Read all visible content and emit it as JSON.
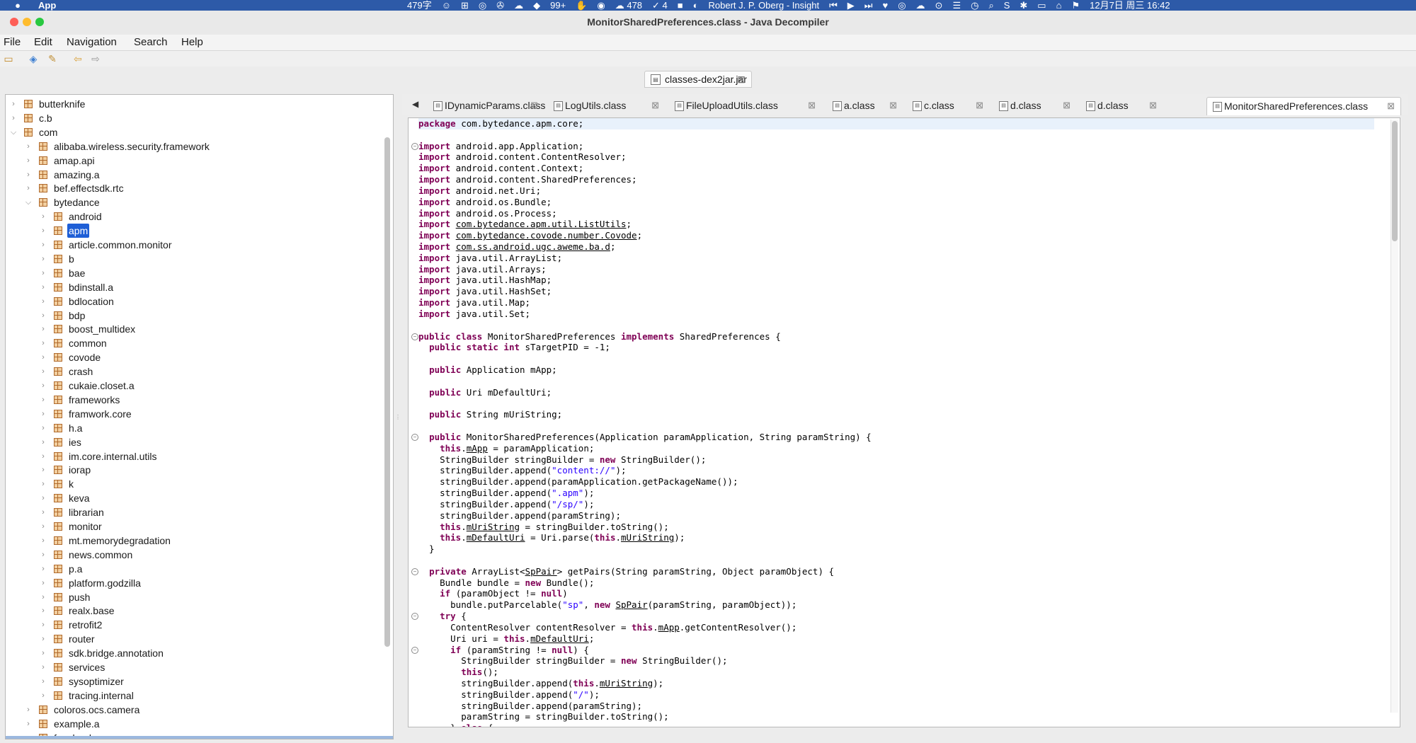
{
  "menubar": {
    "app_name": "App",
    "status": [
      "479字",
      "☺",
      "⊞",
      "◎",
      "✇",
      "☁",
      "◆",
      "99+",
      "✋",
      "◉",
      "☁ 478",
      "✓ 4",
      "■",
      "◐",
      "Robert J. P. Oberg - Insight",
      "⏮",
      "▶",
      "⏭",
      "♥",
      "◎",
      "☁",
      "⊙",
      "☰",
      "◷",
      "⌕",
      "S",
      "✱",
      "▭",
      "⌂",
      "⚑",
      "12月7日 周三  16:42"
    ]
  },
  "window": {
    "title": "MonitorSharedPreferences.class - Java Decompiler"
  },
  "menu": {
    "items": [
      "File",
      "Edit",
      "Navigation",
      "Search",
      "Help"
    ]
  },
  "toolbar": {
    "icons": [
      "open-folder-icon",
      "open-type-icon",
      "search-icon",
      "back-icon",
      "forward-icon"
    ]
  },
  "jar_tab": {
    "label": "classes-dex2jar.jar"
  },
  "tree": [
    {
      "name": "butterknife",
      "depth": 0,
      "expanded": false
    },
    {
      "name": "c.b",
      "depth": 0,
      "expanded": false
    },
    {
      "name": "com",
      "depth": 0,
      "expanded": true
    },
    {
      "name": "alibaba.wireless.security.framework",
      "depth": 1,
      "expanded": false
    },
    {
      "name": "amap.api",
      "depth": 1,
      "expanded": false
    },
    {
      "name": "amazing.a",
      "depth": 1,
      "expanded": false
    },
    {
      "name": "bef.effectsdk.rtc",
      "depth": 1,
      "expanded": false
    },
    {
      "name": "bytedance",
      "depth": 1,
      "expanded": true
    },
    {
      "name": "android",
      "depth": 2,
      "expanded": false
    },
    {
      "name": "apm",
      "depth": 2,
      "expanded": false,
      "selected": true
    },
    {
      "name": "article.common.monitor",
      "depth": 2,
      "expanded": false
    },
    {
      "name": "b",
      "depth": 2,
      "expanded": false
    },
    {
      "name": "bae",
      "depth": 2,
      "expanded": false
    },
    {
      "name": "bdinstall.a",
      "depth": 2,
      "expanded": false
    },
    {
      "name": "bdlocation",
      "depth": 2,
      "expanded": false
    },
    {
      "name": "bdp",
      "depth": 2,
      "expanded": false
    },
    {
      "name": "boost_multidex",
      "depth": 2,
      "expanded": false
    },
    {
      "name": "common",
      "depth": 2,
      "expanded": false
    },
    {
      "name": "covode",
      "depth": 2,
      "expanded": false
    },
    {
      "name": "crash",
      "depth": 2,
      "expanded": false
    },
    {
      "name": "cukaie.closet.a",
      "depth": 2,
      "expanded": false
    },
    {
      "name": "frameworks",
      "depth": 2,
      "expanded": false
    },
    {
      "name": "framwork.core",
      "depth": 2,
      "expanded": false
    },
    {
      "name": "h.a",
      "depth": 2,
      "expanded": false
    },
    {
      "name": "ies",
      "depth": 2,
      "expanded": false
    },
    {
      "name": "im.core.internal.utils",
      "depth": 2,
      "expanded": false
    },
    {
      "name": "iorap",
      "depth": 2,
      "expanded": false
    },
    {
      "name": "k",
      "depth": 2,
      "expanded": false
    },
    {
      "name": "keva",
      "depth": 2,
      "expanded": false
    },
    {
      "name": "librarian",
      "depth": 2,
      "expanded": false
    },
    {
      "name": "monitor",
      "depth": 2,
      "expanded": false
    },
    {
      "name": "mt.memorydegradation",
      "depth": 2,
      "expanded": false
    },
    {
      "name": "news.common",
      "depth": 2,
      "expanded": false
    },
    {
      "name": "p.a",
      "depth": 2,
      "expanded": false
    },
    {
      "name": "platform.godzilla",
      "depth": 2,
      "expanded": false
    },
    {
      "name": "push",
      "depth": 2,
      "expanded": false
    },
    {
      "name": "realx.base",
      "depth": 2,
      "expanded": false
    },
    {
      "name": "retrofit2",
      "depth": 2,
      "expanded": false
    },
    {
      "name": "router",
      "depth": 2,
      "expanded": false
    },
    {
      "name": "sdk.bridge.annotation",
      "depth": 2,
      "expanded": false
    },
    {
      "name": "services",
      "depth": 2,
      "expanded": false
    },
    {
      "name": "sysoptimizer",
      "depth": 2,
      "expanded": false
    },
    {
      "name": "tracing.internal",
      "depth": 2,
      "expanded": false
    },
    {
      "name": "coloros.ocs.camera",
      "depth": 1,
      "expanded": false
    },
    {
      "name": "example.a",
      "depth": 1,
      "expanded": false
    },
    {
      "name": "facebook",
      "depth": 1,
      "expanded": false
    }
  ],
  "editor_tabs": [
    {
      "label": "IDynamicParams.class",
      "active": false
    },
    {
      "label": "LogUtils.class",
      "active": false
    },
    {
      "label": "FileUploadUtils.class",
      "active": false
    },
    {
      "label": "a.class",
      "active": false
    },
    {
      "label": "c.class",
      "active": false
    },
    {
      "label": "d.class",
      "active": false
    },
    {
      "label": "d.class",
      "active": false
    },
    {
      "label": "MonitorSharedPreferences.class",
      "active": true
    }
  ],
  "tab_close_glyph": "⊠",
  "code_lines": [
    [
      [
        "kw",
        "package"
      ],
      [
        "t",
        " com.bytedance.apm.core;"
      ]
    ],
    [],
    [
      [
        "kw",
        "import"
      ],
      [
        "t",
        " android.app.Application;"
      ]
    ],
    [
      [
        "kw",
        "import"
      ],
      [
        "t",
        " android.content.ContentResolver;"
      ]
    ],
    [
      [
        "kw",
        "import"
      ],
      [
        "t",
        " android.content.Context;"
      ]
    ],
    [
      [
        "kw",
        "import"
      ],
      [
        "t",
        " android.content.SharedPreferences;"
      ]
    ],
    [
      [
        "kw",
        "import"
      ],
      [
        "t",
        " android.net.Uri;"
      ]
    ],
    [
      [
        "kw",
        "import"
      ],
      [
        "t",
        " android.os.Bundle;"
      ]
    ],
    [
      [
        "kw",
        "import"
      ],
      [
        "t",
        " android.os.Process;"
      ]
    ],
    [
      [
        "kw",
        "import"
      ],
      [
        "t",
        " "
      ],
      [
        "u",
        "com.bytedance.apm.util.ListUtils"
      ],
      [
        "t",
        ";"
      ]
    ],
    [
      [
        "kw",
        "import"
      ],
      [
        "t",
        " "
      ],
      [
        "u",
        "com.bytedance.covode.number.Covode"
      ],
      [
        "t",
        ";"
      ]
    ],
    [
      [
        "kw",
        "import"
      ],
      [
        "t",
        " "
      ],
      [
        "u",
        "com.ss.android.ugc.aweme.ba.d"
      ],
      [
        "t",
        ";"
      ]
    ],
    [
      [
        "kw",
        "import"
      ],
      [
        "t",
        " java.util.ArrayList;"
      ]
    ],
    [
      [
        "kw",
        "import"
      ],
      [
        "t",
        " java.util.Arrays;"
      ]
    ],
    [
      [
        "kw",
        "import"
      ],
      [
        "t",
        " java.util.HashMap;"
      ]
    ],
    [
      [
        "kw",
        "import"
      ],
      [
        "t",
        " java.util.HashSet;"
      ]
    ],
    [
      [
        "kw",
        "import"
      ],
      [
        "t",
        " java.util.Map;"
      ]
    ],
    [
      [
        "kw",
        "import"
      ],
      [
        "t",
        " java.util.Set;"
      ]
    ],
    [],
    [
      [
        "kw",
        "public class"
      ],
      [
        "t",
        " MonitorSharedPreferences "
      ],
      [
        "kw",
        "implements"
      ],
      [
        "t",
        " SharedPreferences {"
      ]
    ],
    [
      [
        "t",
        "  "
      ],
      [
        "kw",
        "public static int"
      ],
      [
        "t",
        " sTargetPID = -1;"
      ]
    ],
    [],
    [
      [
        "t",
        "  "
      ],
      [
        "kw",
        "public"
      ],
      [
        "t",
        " Application mApp;"
      ]
    ],
    [],
    [
      [
        "t",
        "  "
      ],
      [
        "kw",
        "public"
      ],
      [
        "t",
        " Uri mDefaultUri;"
      ]
    ],
    [],
    [
      [
        "t",
        "  "
      ],
      [
        "kw",
        "public"
      ],
      [
        "t",
        " String mUriString;"
      ]
    ],
    [],
    [
      [
        "t",
        "  "
      ],
      [
        "kw",
        "public"
      ],
      [
        "t",
        " MonitorSharedPreferences(Application paramApplication, String paramString) {"
      ]
    ],
    [
      [
        "t",
        "    "
      ],
      [
        "kw",
        "this"
      ],
      [
        "t",
        "."
      ],
      [
        "u",
        "mApp"
      ],
      [
        "t",
        " = paramApplication;"
      ]
    ],
    [
      [
        "t",
        "    StringBuilder stringBuilder = "
      ],
      [
        "kw",
        "new"
      ],
      [
        "t",
        " StringBuilder();"
      ]
    ],
    [
      [
        "t",
        "    stringBuilder.append("
      ],
      [
        "str",
        "\"content://\""
      ],
      [
        "t",
        ");"
      ]
    ],
    [
      [
        "t",
        "    stringBuilder.append(paramApplication.getPackageName());"
      ]
    ],
    [
      [
        "t",
        "    stringBuilder.append("
      ],
      [
        "str",
        "\".apm\""
      ],
      [
        "t",
        ");"
      ]
    ],
    [
      [
        "t",
        "    stringBuilder.append("
      ],
      [
        "str",
        "\"/sp/\""
      ],
      [
        "t",
        ");"
      ]
    ],
    [
      [
        "t",
        "    stringBuilder.append(paramString);"
      ]
    ],
    [
      [
        "t",
        "    "
      ],
      [
        "kw",
        "this"
      ],
      [
        "t",
        "."
      ],
      [
        "u",
        "mUriString"
      ],
      [
        "t",
        " = stringBuilder.toString();"
      ]
    ],
    [
      [
        "t",
        "    "
      ],
      [
        "kw",
        "this"
      ],
      [
        "t",
        "."
      ],
      [
        "u",
        "mDefaultUri"
      ],
      [
        "t",
        " = Uri.parse("
      ],
      [
        "kw",
        "this"
      ],
      [
        "t",
        "."
      ],
      [
        "u",
        "mUriString"
      ],
      [
        "t",
        ");"
      ]
    ],
    [
      [
        "t",
        "  }"
      ]
    ],
    [],
    [
      [
        "t",
        "  "
      ],
      [
        "kw",
        "private"
      ],
      [
        "t",
        " ArrayList<"
      ],
      [
        "u",
        "SpPair"
      ],
      [
        "t",
        "> getPairs(String paramString, Object paramObject) {"
      ]
    ],
    [
      [
        "t",
        "    Bundle bundle = "
      ],
      [
        "kw",
        "new"
      ],
      [
        "t",
        " Bundle();"
      ]
    ],
    [
      [
        "t",
        "    "
      ],
      [
        "kw",
        "if"
      ],
      [
        "t",
        " (paramObject != "
      ],
      [
        "kw",
        "null"
      ],
      [
        "t",
        ")"
      ]
    ],
    [
      [
        "t",
        "      bundle.putParcelable("
      ],
      [
        "str",
        "\"sp\""
      ],
      [
        "t",
        ", "
      ],
      [
        "kw",
        "new"
      ],
      [
        "t",
        " "
      ],
      [
        "u",
        "SpPair"
      ],
      [
        "t",
        "(paramString, paramObject));"
      ]
    ],
    [
      [
        "t",
        "    "
      ],
      [
        "kw",
        "try"
      ],
      [
        "t",
        " {"
      ]
    ],
    [
      [
        "t",
        "      ContentResolver contentResolver = "
      ],
      [
        "kw",
        "this"
      ],
      [
        "t",
        "."
      ],
      [
        "u",
        "mApp"
      ],
      [
        "t",
        ".getContentResolver();"
      ]
    ],
    [
      [
        "t",
        "      Uri uri = "
      ],
      [
        "kw",
        "this"
      ],
      [
        "t",
        "."
      ],
      [
        "u",
        "mDefaultUri"
      ],
      [
        "t",
        ";"
      ]
    ],
    [
      [
        "t",
        "      "
      ],
      [
        "kw",
        "if"
      ],
      [
        "t",
        " (paramString != "
      ],
      [
        "kw",
        "null"
      ],
      [
        "t",
        ") {"
      ]
    ],
    [
      [
        "t",
        "        StringBuilder stringBuilder = "
      ],
      [
        "kw",
        "new"
      ],
      [
        "t",
        " StringBuilder();"
      ]
    ],
    [
      [
        "t",
        "        "
      ],
      [
        "kw",
        "this"
      ],
      [
        "t",
        "();"
      ]
    ],
    [
      [
        "t",
        "        stringBuilder.append("
      ],
      [
        "kw",
        "this"
      ],
      [
        "t",
        "."
      ],
      [
        "u",
        "mUriString"
      ],
      [
        "t",
        ");"
      ]
    ],
    [
      [
        "t",
        "        stringBuilder.append("
      ],
      [
        "str",
        "\"/\""
      ],
      [
        "t",
        ");"
      ]
    ],
    [
      [
        "t",
        "        stringBuilder.append(paramString);"
      ]
    ],
    [
      [
        "t",
        "        paramString = stringBuilder.toString();"
      ]
    ],
    [
      [
        "t",
        "      } "
      ],
      [
        "kw",
        "else"
      ],
      [
        "t",
        " {"
      ]
    ]
  ]
}
